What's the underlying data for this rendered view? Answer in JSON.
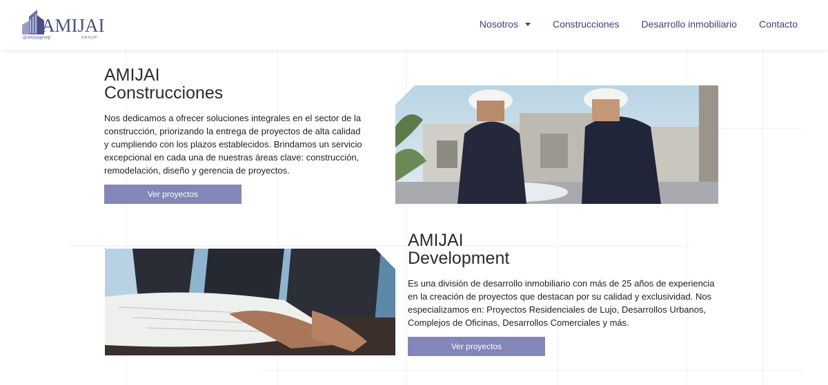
{
  "header": {
    "logo": {
      "wordmark": "AMIJAI",
      "handle": "@amijaigroup",
      "tag": "GROUP"
    },
    "nav": [
      {
        "label": "Nosotros",
        "has_dropdown": true
      },
      {
        "label": "Construcciones",
        "has_dropdown": false
      },
      {
        "label": "Desarrollo inmobiliario",
        "has_dropdown": false
      },
      {
        "label": "Contacto",
        "has_dropdown": false
      }
    ]
  },
  "sections": {
    "construcciones": {
      "title_line1": "AMIJAI",
      "title_line2": "Construcciones",
      "description": "Nos dedicamos a ofrecer soluciones integrales en el sector de la construcción, priorizando la entrega de proyectos de alta calidad y cumpliendo con los plazos establecidos. Brindamos un servicio excepcional en cada una de nuestras áreas clave: construcción, remodelación, diseño y gerencia de proyectos.",
      "button": "Ver proyectos"
    },
    "development": {
      "title_line1": "AMIJAI",
      "title_line2": "Development",
      "description": "Es una división de desarrollo inmobiliario con más de 25 años de experiencia en la creación de proyectos que destacan por su calidad y exclusividad. Nos especializamos en: Proyectos Residenciales de Lujo, Desarrollos Urbanos, Complejos de Oficinas, Desarrollos Comerciales y más.",
      "button": "Ver proyectos"
    }
  },
  "colors": {
    "accent": "#8386b8",
    "nav_text": "#3c4274",
    "logo": "#4a4f85"
  }
}
